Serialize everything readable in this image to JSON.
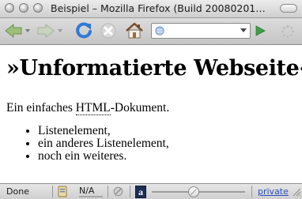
{
  "window": {
    "title": "Beispiel – Mozilla Firefox (Build 20080201…"
  },
  "toolbar": {
    "back_icon": "back-arrow-icon",
    "forward_icon": "forward-arrow-icon",
    "reload_icon": "reload-icon",
    "stop_icon": "stop-icon",
    "home_icon": "home-icon",
    "url": {
      "value": ""
    },
    "go_icon": "go-arrow-icon",
    "colors": {
      "reload": "#2f78d8",
      "go": "#3ea046"
    }
  },
  "page": {
    "heading": "»Unformatierte Webseite«",
    "paragraph": {
      "before": "Ein einfaches ",
      "abbr": "HTML",
      "after": "-Dokument."
    },
    "list": [
      "Listenelement,",
      "ein anderes Listenelement,",
      "noch ein weiteres."
    ]
  },
  "statusbar": {
    "status": "Done",
    "na": "N/A",
    "private_link": "private"
  }
}
